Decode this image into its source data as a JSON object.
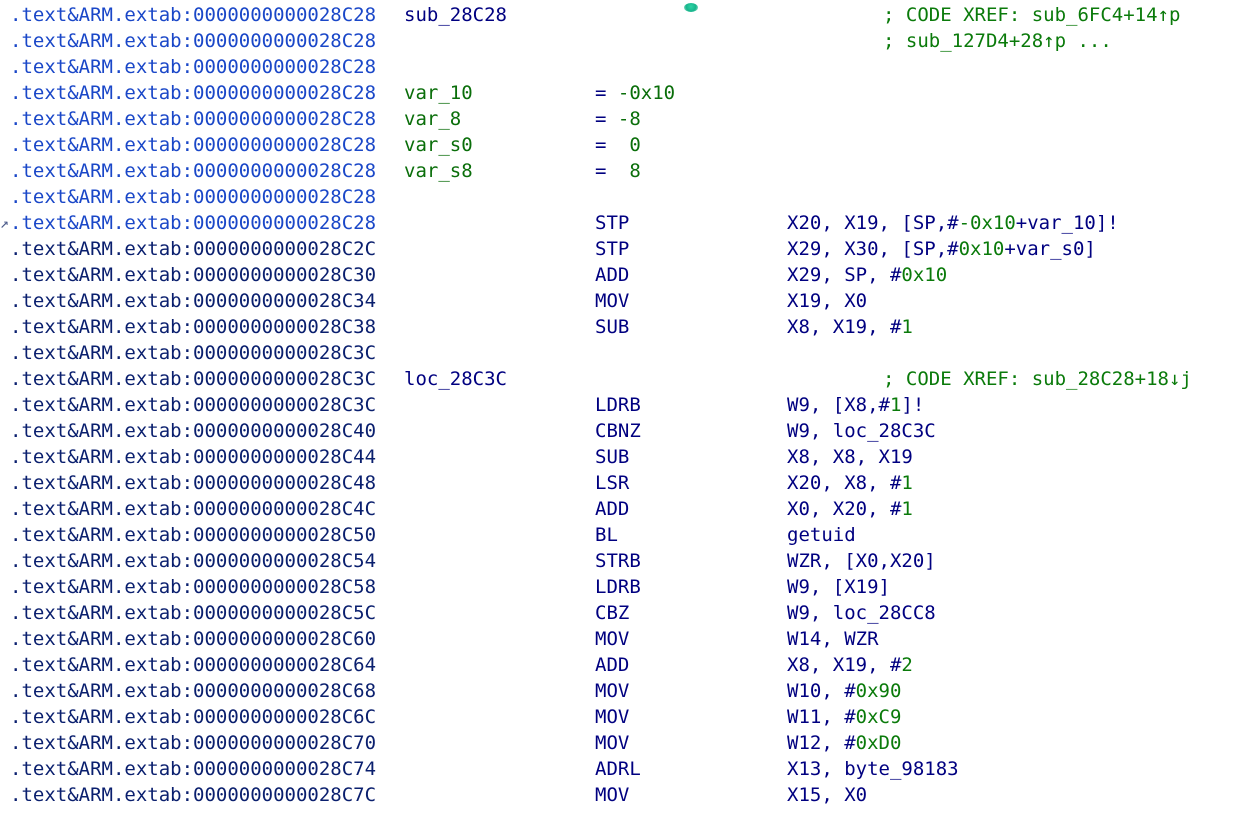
{
  "listing": {
    "rows": [
      {
        "mark": "",
        "addr": ".text&ARM.extab:0000000000028C28",
        "addr_style": "head",
        "label": "sub_28C28",
        "label_style": "sub",
        "mnem": "",
        "ops": "",
        "comment": "; CODE XREF: sub_6FC4+14↑p"
      },
      {
        "mark": "",
        "addr": ".text&ARM.extab:0000000000028C28",
        "addr_style": "head",
        "label": "",
        "label_style": "",
        "mnem": "",
        "ops": "",
        "comment": "; sub_127D4+28↑p ..."
      },
      {
        "mark": "",
        "addr": ".text&ARM.extab:0000000000028C28",
        "addr_style": "head",
        "label": "",
        "label_style": "",
        "mnem": "",
        "ops": "",
        "comment": ""
      },
      {
        "mark": "",
        "addr": ".text&ARM.extab:0000000000028C28",
        "addr_style": "head",
        "label": "var_10",
        "label_style": "var",
        "mnem": "= ",
        "eqval": "-0x10",
        "ops": "",
        "comment": ""
      },
      {
        "mark": "",
        "addr": ".text&ARM.extab:0000000000028C28",
        "addr_style": "head",
        "label": "var_8",
        "label_style": "var",
        "mnem": "= ",
        "eqval": "-8",
        "ops": "",
        "comment": ""
      },
      {
        "mark": "",
        "addr": ".text&ARM.extab:0000000000028C28",
        "addr_style": "head",
        "label": "var_s0",
        "label_style": "var",
        "mnem": "=  ",
        "eqval": "0",
        "ops": "",
        "comment": ""
      },
      {
        "mark": "",
        "addr": ".text&ARM.extab:0000000000028C28",
        "addr_style": "head",
        "label": "var_s8",
        "label_style": "var",
        "mnem": "=  ",
        "eqval": "8",
        "ops": "",
        "comment": ""
      },
      {
        "mark": "",
        "addr": ".text&ARM.extab:0000000000028C28",
        "addr_style": "head",
        "label": "",
        "label_style": "",
        "mnem": "",
        "ops": "",
        "comment": ""
      },
      {
        "mark": "↗",
        "addr": ".text&ARM.extab:0000000000028C28",
        "addr_style": "head",
        "label": "",
        "label_style": "",
        "mnem": "STP",
        "ops": [
          [
            "X20, X19, [SP,#",
            ""
          ],
          [
            "-0x10",
            "n"
          ],
          [
            "+var_10]!",
            ""
          ]
        ],
        "comment": ""
      },
      {
        "mark": "",
        "addr": ".text&ARM.extab:0000000000028C2C",
        "addr_style": "code",
        "label": "",
        "label_style": "",
        "mnem": "STP",
        "ops": [
          [
            "X29, X30, [SP,#",
            ""
          ],
          [
            "0x10",
            "n"
          ],
          [
            "+var_s0]",
            ""
          ]
        ],
        "comment": ""
      },
      {
        "mark": "",
        "addr": ".text&ARM.extab:0000000000028C30",
        "addr_style": "code",
        "label": "",
        "label_style": "",
        "mnem": "ADD",
        "ops": [
          [
            "X29, SP, #",
            ""
          ],
          [
            "0x10",
            "n"
          ]
        ],
        "comment": ""
      },
      {
        "mark": "",
        "addr": ".text&ARM.extab:0000000000028C34",
        "addr_style": "code",
        "label": "",
        "label_style": "",
        "mnem": "MOV",
        "ops": [
          [
            "X19, X0",
            ""
          ]
        ],
        "comment": ""
      },
      {
        "mark": "",
        "addr": ".text&ARM.extab:0000000000028C38",
        "addr_style": "code",
        "label": "",
        "label_style": "",
        "mnem": "SUB",
        "ops": [
          [
            "X8, X19, #",
            ""
          ],
          [
            "1",
            "n"
          ]
        ],
        "comment": ""
      },
      {
        "mark": "",
        "addr": ".text&ARM.extab:0000000000028C3C",
        "addr_style": "code",
        "label": "",
        "label_style": "",
        "mnem": "",
        "ops": "",
        "comment": ""
      },
      {
        "mark": "",
        "addr": ".text&ARM.extab:0000000000028C3C",
        "addr_style": "code",
        "label": "loc_28C3C",
        "label_style": "loc",
        "mnem": "",
        "ops": "",
        "comment": "; CODE XREF: sub_28C28+18↓j"
      },
      {
        "mark": "",
        "addr": ".text&ARM.extab:0000000000028C3C",
        "addr_style": "code",
        "label": "",
        "label_style": "",
        "mnem": "LDRB",
        "ops": [
          [
            "W9, [X8,#",
            ""
          ],
          [
            "1",
            "n"
          ],
          [
            "]!",
            ""
          ]
        ],
        "comment": ""
      },
      {
        "mark": "",
        "addr": ".text&ARM.extab:0000000000028C40",
        "addr_style": "code",
        "label": "",
        "label_style": "",
        "mnem": "CBNZ",
        "ops": [
          [
            "W9, loc_28C3C",
            ""
          ]
        ],
        "comment": ""
      },
      {
        "mark": "",
        "addr": ".text&ARM.extab:0000000000028C44",
        "addr_style": "code",
        "label": "",
        "label_style": "",
        "mnem": "SUB",
        "ops": [
          [
            "X8, X8, X19",
            ""
          ]
        ],
        "comment": ""
      },
      {
        "mark": "",
        "addr": ".text&ARM.extab:0000000000028C48",
        "addr_style": "code",
        "label": "",
        "label_style": "",
        "mnem": "LSR",
        "ops": [
          [
            "X20, X8, #",
            ""
          ],
          [
            "1",
            "n"
          ]
        ],
        "comment": ""
      },
      {
        "mark": "",
        "addr": ".text&ARM.extab:0000000000028C4C",
        "addr_style": "code",
        "label": "",
        "label_style": "",
        "mnem": "ADD",
        "ops": [
          [
            "X0, X20, #",
            ""
          ],
          [
            "1",
            "n"
          ]
        ],
        "comment": ""
      },
      {
        "mark": "",
        "addr": ".text&ARM.extab:0000000000028C50",
        "addr_style": "code",
        "label": "",
        "label_style": "",
        "mnem": "BL",
        "ops": [
          [
            "getuid",
            ""
          ]
        ],
        "comment": ""
      },
      {
        "mark": "",
        "addr": ".text&ARM.extab:0000000000028C54",
        "addr_style": "code",
        "label": "",
        "label_style": "",
        "mnem": "STRB",
        "ops": [
          [
            "WZR, [X0,X20]",
            ""
          ]
        ],
        "comment": ""
      },
      {
        "mark": "",
        "addr": ".text&ARM.extab:0000000000028C58",
        "addr_style": "code",
        "label": "",
        "label_style": "",
        "mnem": "LDRB",
        "ops": [
          [
            "W9, [X19]",
            ""
          ]
        ],
        "comment": ""
      },
      {
        "mark": "",
        "addr": ".text&ARM.extab:0000000000028C5C",
        "addr_style": "code",
        "label": "",
        "label_style": "",
        "mnem": "CBZ",
        "ops": [
          [
            "W9, loc_28CC8",
            ""
          ]
        ],
        "comment": ""
      },
      {
        "mark": "",
        "addr": ".text&ARM.extab:0000000000028C60",
        "addr_style": "code",
        "label": "",
        "label_style": "",
        "mnem": "MOV",
        "ops": [
          [
            "W14, WZR",
            ""
          ]
        ],
        "comment": ""
      },
      {
        "mark": "",
        "addr": ".text&ARM.extab:0000000000028C64",
        "addr_style": "code",
        "label": "",
        "label_style": "",
        "mnem": "ADD",
        "ops": [
          [
            "X8, X19, #",
            ""
          ],
          [
            "2",
            "n"
          ]
        ],
        "comment": ""
      },
      {
        "mark": "",
        "addr": ".text&ARM.extab:0000000000028C68",
        "addr_style": "code",
        "label": "",
        "label_style": "",
        "mnem": "MOV",
        "ops": [
          [
            "W10, #",
            ""
          ],
          [
            "0x90",
            "n"
          ]
        ],
        "comment": ""
      },
      {
        "mark": "",
        "addr": ".text&ARM.extab:0000000000028C6C",
        "addr_style": "code",
        "label": "",
        "label_style": "",
        "mnem": "MOV",
        "ops": [
          [
            "W11, #",
            ""
          ],
          [
            "0xC9",
            "n"
          ]
        ],
        "comment": ""
      },
      {
        "mark": "",
        "addr": ".text&ARM.extab:0000000000028C70",
        "addr_style": "code",
        "label": "",
        "label_style": "",
        "mnem": "MOV",
        "ops": [
          [
            "W12, #",
            ""
          ],
          [
            "0xD0",
            "n"
          ]
        ],
        "comment": ""
      },
      {
        "mark": "",
        "addr": ".text&ARM.extab:0000000000028C74",
        "addr_style": "code",
        "label": "",
        "label_style": "",
        "mnem": "ADRL",
        "ops": [
          [
            "X13, byte_98183",
            ""
          ]
        ],
        "comment": ""
      },
      {
        "mark": "",
        "addr": ".text&ARM.extab:0000000000028C7C",
        "addr_style": "code",
        "label": "",
        "label_style": "",
        "mnem": "MOV",
        "ops": [
          [
            "X15, X0",
            ""
          ]
        ],
        "comment": ""
      }
    ]
  },
  "colors": {
    "address_header": "#1a47c8",
    "address_code": "#0a1f6e",
    "mnemonic": "#000080",
    "numeric": "#0a7a0a",
    "comment": "#0a7a0a",
    "background": "#ffffff"
  },
  "icons": {
    "cursor": "cursor-dot-icon"
  }
}
